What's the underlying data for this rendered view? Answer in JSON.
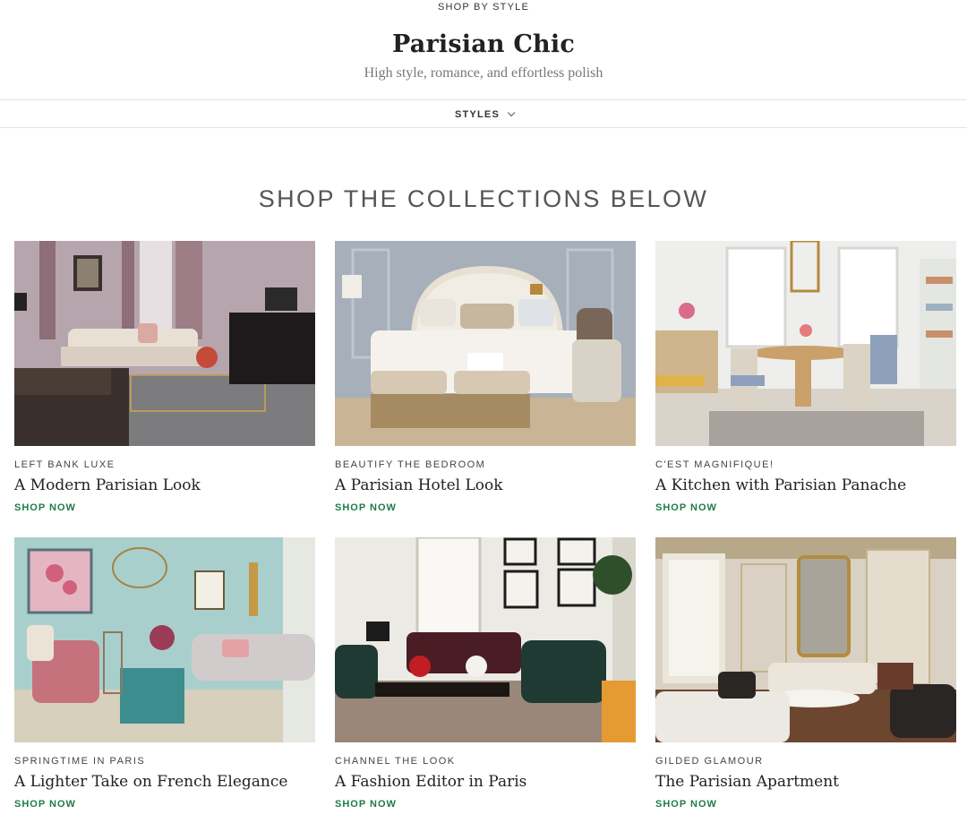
{
  "header": {
    "eyebrow": "SHOP BY STYLE",
    "title": "Parisian Chic",
    "subtitle": "High style, romance, and effortless polish",
    "styles_label": "STYLES"
  },
  "section": {
    "heading": "SHOP THE COLLECTIONS BELOW"
  },
  "cards": [
    {
      "eyebrow": "LEFT BANK LUXE",
      "title": "A Modern Parisian Look",
      "cta": "SHOP NOW"
    },
    {
      "eyebrow": "BEAUTIFY THE BEDROOM",
      "title": "A Parisian Hotel Look",
      "cta": "SHOP NOW"
    },
    {
      "eyebrow": "C'EST MAGNIFIQUE!",
      "title": "A Kitchen with Parisian Panache",
      "cta": "SHOP NOW"
    },
    {
      "eyebrow": "SPRINGTIME IN PARIS",
      "title": "A Lighter Take on French Elegance",
      "cta": "SHOP NOW"
    },
    {
      "eyebrow": "CHANNEL THE LOOK",
      "title": "A Fashion Editor in Paris",
      "cta": "SHOP NOW"
    },
    {
      "eyebrow": "GILDED GLAMOUR",
      "title": "The Parisian Apartment",
      "cta": "SHOP NOW"
    }
  ],
  "colors": {
    "accent_green": "#1f7a4c",
    "rule": "#e3e3e3"
  }
}
